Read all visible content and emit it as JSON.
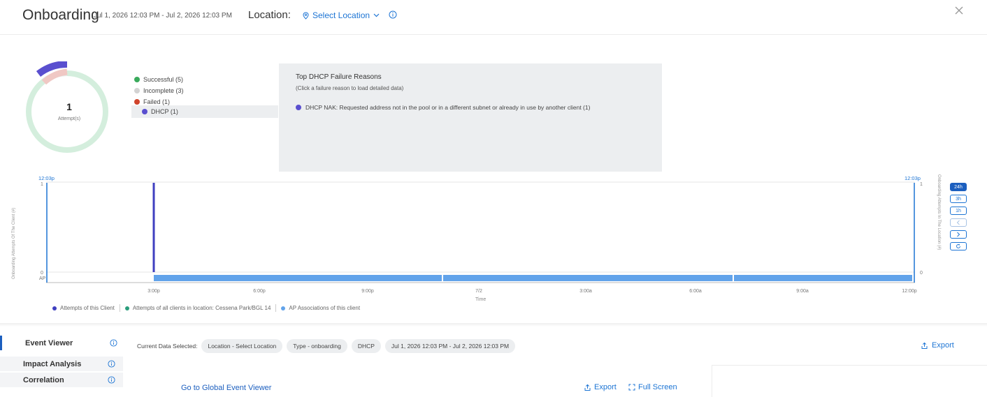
{
  "header": {
    "title": "Onboarding",
    "date_range": "Jul 1, 2026 12:03 PM - Jul 2, 2026 12:03 PM",
    "location_label": "Location:",
    "location_select": "Select Location"
  },
  "summary": {
    "attempt_count": "1",
    "attempt_label": "Attempt(s)",
    "legend": [
      {
        "label": "Successful (5)",
        "color": "#3aaa5c"
      },
      {
        "label": "Incomplete (3)",
        "color": "#d3d3d3"
      },
      {
        "label": "Failed (1)",
        "color": "#d0442c"
      }
    ],
    "selected_sub": {
      "label": "DHCP (1)",
      "color": "#5a4fcf"
    }
  },
  "failure_panel": {
    "title": "Top DHCP Failure Reasons",
    "subtitle": "(Click a failure reason to load detailed data)",
    "items": [
      {
        "label": "DHCP NAK: Requested address not in the pool or in a different subnet or already in use by another client (1)",
        "color": "#5a4fcf"
      }
    ]
  },
  "chart_data": {
    "type": "bar",
    "title": "",
    "ylabel_left": "Onboarding Attempts Of The Client (#)",
    "ylabel_right": "Onboarding Attempts In The Location (#)",
    "xlabel": "Time",
    "start_label": "12:03p",
    "end_label": "12:03p",
    "y_ticks": [
      "1",
      "0"
    ],
    "right_y_ticks": [
      "1",
      "0"
    ],
    "x_ticks": [
      "3:00p",
      "6:00p",
      "9:00p",
      "7/2",
      "3:00a",
      "6:00a",
      "9:00a",
      "12:00p"
    ],
    "ylim": [
      0,
      1
    ],
    "ap_row_label": "AP",
    "series": [
      {
        "name": "Attempts of this Client",
        "color": "#3f3fc0",
        "points": [
          {
            "x": "3:00p",
            "y": 1
          }
        ]
      },
      {
        "name": "Attempts of all clients in location: Cessena Park/BGL 14",
        "color": "#2a9d7c",
        "points": []
      },
      {
        "name": "AP Associations of this client",
        "color": "#62a3ea",
        "spans": [
          [
            "3:00p",
            "12:00p"
          ]
        ]
      }
    ],
    "legend": [
      {
        "name": "Attempts of this Client",
        "color": "#3f3fc0"
      },
      {
        "name": "Attempts of all clients in location: Cessena Park/BGL 14",
        "color": "#2a9d7c"
      },
      {
        "name": "AP Associations of this client",
        "color": "#62a3ea"
      }
    ]
  },
  "time_buttons": [
    "24h",
    "3h",
    "1h"
  ],
  "bottom": {
    "nav": [
      "Event Viewer",
      "Impact Analysis",
      "Correlation"
    ],
    "current_label": "Current Data Selected:",
    "chips": [
      "Location - Select Location",
      "Type - onboarding",
      "DHCP",
      "Jul 1, 2026 12:03 PM - Jul 2, 2026 12:03 PM"
    ],
    "export": "Export",
    "global_event_viewer": "Go to Global Event Viewer",
    "ev_export": "Export",
    "full_screen": "Full Screen"
  },
  "colors": {
    "accent": "#1c74d4",
    "successful": "#3aaa5c",
    "failed": "#d0442c",
    "dhcp": "#5a4fcf"
  }
}
